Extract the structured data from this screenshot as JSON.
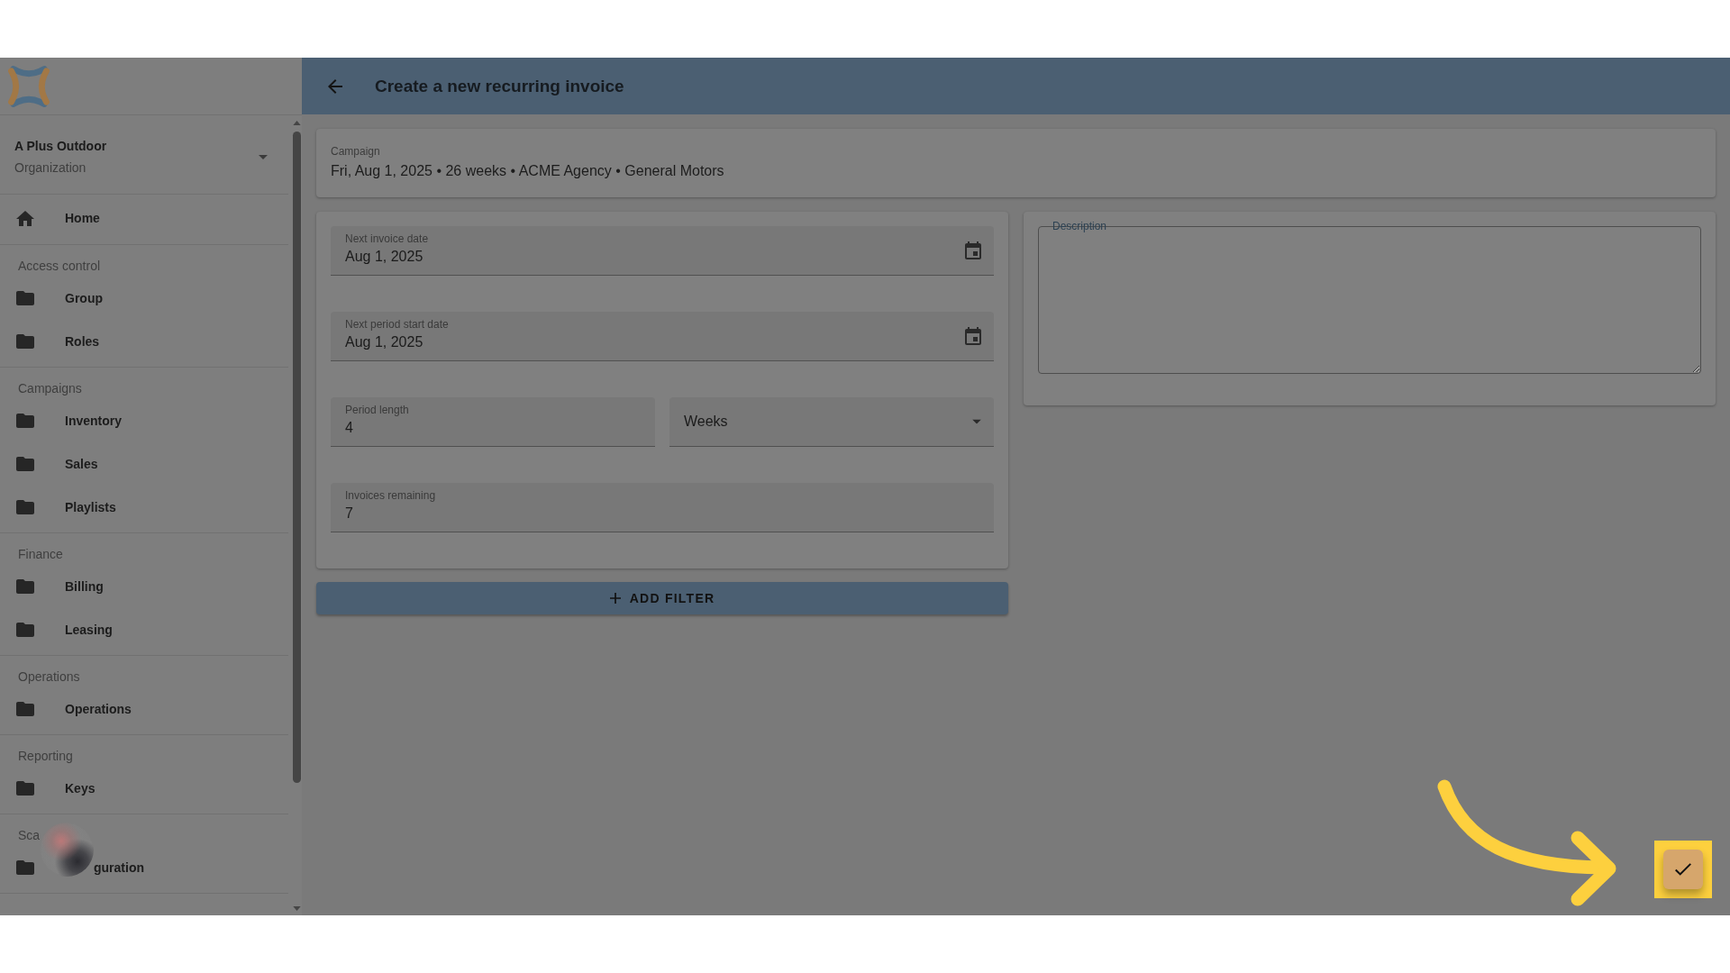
{
  "sidebar": {
    "organization": {
      "name": "A Plus Outdoor",
      "type": "Organization"
    },
    "home": {
      "label": "Home"
    },
    "sections": [
      {
        "title": "Access control",
        "items": [
          {
            "label": "Group"
          },
          {
            "label": "Roles"
          }
        ]
      },
      {
        "title": "Campaigns",
        "items": [
          {
            "label": "Inventory"
          },
          {
            "label": "Sales"
          },
          {
            "label": "Playlists"
          }
        ]
      },
      {
        "title": "Finance",
        "items": [
          {
            "label": "Billing"
          },
          {
            "label": "Leasing"
          }
        ]
      },
      {
        "title": "Operations",
        "items": [
          {
            "label": "Operations"
          }
        ]
      },
      {
        "title": "Reporting",
        "items": [
          {
            "label": "Keys"
          }
        ]
      },
      {
        "title": "Sca",
        "items": [
          {
            "label": "guration"
          }
        ]
      }
    ]
  },
  "header": {
    "title": "Create a new recurring invoice"
  },
  "campaign": {
    "label": "Campaign",
    "value": "Fri, Aug 1, 2025 • 26 weeks • ACME Agency • General Motors"
  },
  "form": {
    "rows": [
      {
        "fields": [
          {
            "kind": "date",
            "label": "Next invoice date",
            "value": "Aug 1, 2025"
          }
        ]
      },
      {
        "fields": [
          {
            "kind": "date",
            "label": "Next period start date",
            "value": "Aug 1, 2025"
          }
        ]
      },
      {
        "fields": [
          {
            "kind": "number",
            "label": "Period length",
            "value": "4"
          },
          {
            "kind": "select",
            "value": "Weeks"
          }
        ]
      },
      {
        "fields": [
          {
            "kind": "number",
            "label": "Invoices remaining",
            "value": "7"
          }
        ]
      }
    ],
    "add_filter": {
      "label": "ADD FILTER"
    }
  },
  "description": {
    "label": "Description"
  },
  "confirm_button": {
    "highlighted": true
  }
}
